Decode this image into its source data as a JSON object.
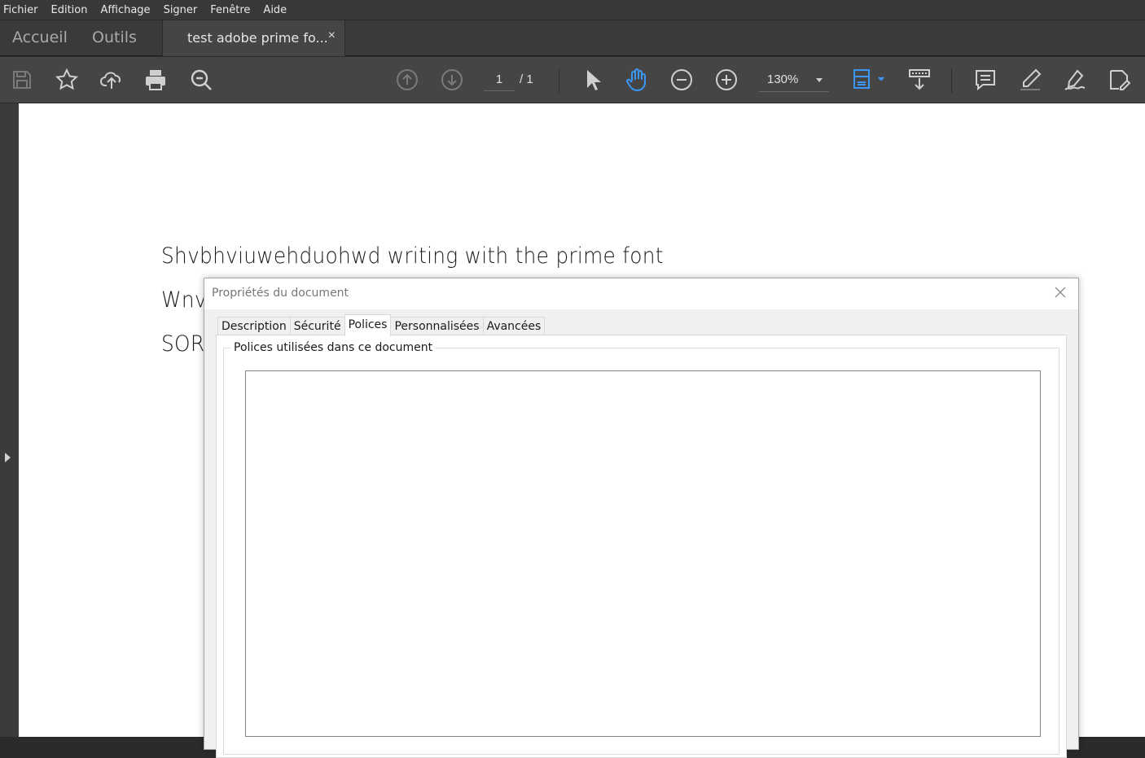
{
  "menu": [
    "Fichier",
    "Edition",
    "Affichage",
    "Signer",
    "Fenêtre",
    "Aide"
  ],
  "nav": {
    "home": "Accueil",
    "tools": "Outils"
  },
  "doc_tab": {
    "title": "test adobe prime fo...",
    "close": "×"
  },
  "toolbar": {
    "page_current": "1",
    "page_total": "/  1",
    "zoom": "130%",
    "accent_color": "#3a97f5",
    "icon_color": "#d0d0d0",
    "disabled_icon_color": "#7a7a7a",
    "icons": [
      "save-icon",
      "star-icon",
      "upload-cloud-icon",
      "print-icon",
      "zoom-search-icon",
      "page-up-icon",
      "page-down-icon",
      "select-arrow-icon",
      "hand-icon",
      "zoom-out-icon",
      "zoom-in-icon",
      "fit-page-icon",
      "scroll-mode-icon",
      "comment-icon",
      "highlight-icon",
      "fill-sign-icon",
      "edit-pdf-icon"
    ]
  },
  "document": {
    "lines": [
      "Shvbhviuwehduohwd writing with the prime font",
      "Wnv",
      "SOR"
    ]
  },
  "dialog": {
    "title": "Propriétés du document",
    "tabs": [
      "Description",
      "Sécurité",
      "Polices",
      "Personnalisées",
      "Avancées"
    ],
    "active_tab": "Polices",
    "group_label": "Polices utilisées dans ce document"
  }
}
